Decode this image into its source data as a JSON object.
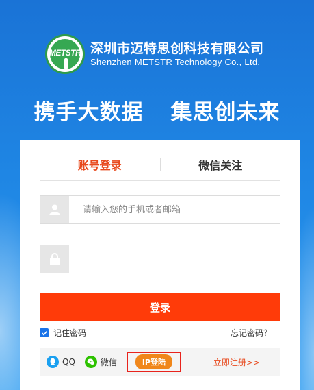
{
  "company": {
    "name_cn": "深圳市迈特思创科技有限公司",
    "name_en": "Shenzhen METSTR Technology Co., Ltd.",
    "logo_text": "METSTR"
  },
  "slogan": {
    "left": "携手大数据",
    "right": "集思创未来"
  },
  "tabs": [
    {
      "label": "账号登录",
      "active": true
    },
    {
      "label": "微信关注",
      "active": false
    }
  ],
  "form": {
    "account_placeholder": "请输入您的手机或者邮箱",
    "account_value": "",
    "password_value": "",
    "login_label": "登录",
    "remember_label": "记住密码",
    "remember_checked": true,
    "forgot_label": "忘记密码？"
  },
  "bottom": {
    "qq_label": "QQ",
    "wechat_label": "微信",
    "ip_label": "IP登陆",
    "register_label": "立即注册>>"
  },
  "colors": {
    "accent": "#ff3b09",
    "tab_active": "#e8491d",
    "ip_badge": "#f0861a",
    "highlight_box": "#e8231c",
    "qq": "#1aa0f0",
    "wechat": "#2dc100"
  },
  "icons": [
    "user-icon",
    "lock-icon",
    "check-icon",
    "qq-icon",
    "wechat-icon"
  ]
}
